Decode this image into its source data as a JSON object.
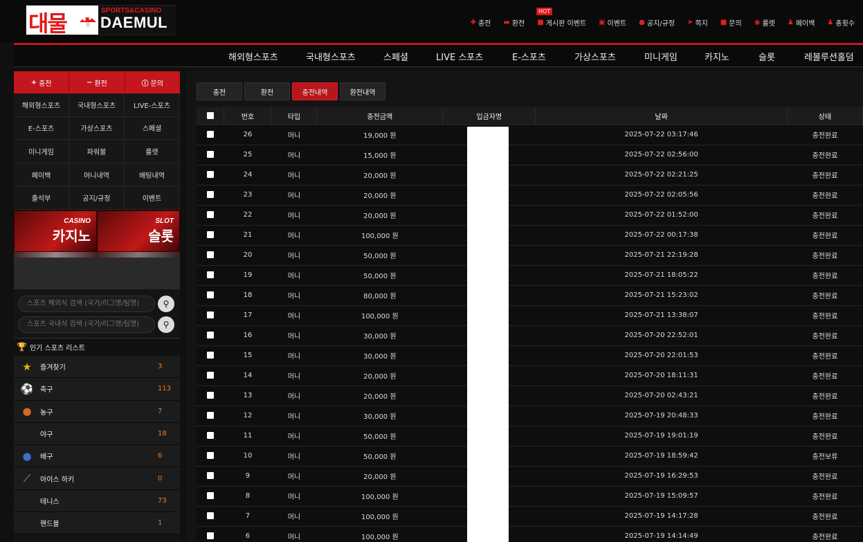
{
  "brand": {
    "logo_kr": "대물",
    "logo_sub": "SPORTS&CASINO",
    "logo_en": "DAEMUL"
  },
  "util_nav": [
    {
      "icon": "plus-icon",
      "label": "충전"
    },
    {
      "icon": "minus-icon",
      "label": "환전"
    },
    {
      "icon": "board-icon",
      "label": "게시판 이벤트"
    },
    {
      "icon": "calendar-icon",
      "label": "이벤트"
    },
    {
      "icon": "notice-icon",
      "label": "공지/규정"
    },
    {
      "icon": "message-icon",
      "label": "쪽지"
    },
    {
      "icon": "inquiry-icon",
      "label": "문의"
    },
    {
      "icon": "roulette-icon",
      "label": "룰렛"
    },
    {
      "icon": "payback-icon",
      "label": "페이백"
    },
    {
      "icon": "attendance-icon",
      "label": "총횟수"
    }
  ],
  "hot_badge": "HOT",
  "main_nav": [
    "해외형스포츠",
    "국내형스포츠",
    "스페셜",
    "LIVE 스포츠",
    "E-스포츠",
    "가상스포츠",
    "미니게임",
    "카지노",
    "슬롯",
    "레볼루션홀덤"
  ],
  "sidebar": {
    "actions": [
      {
        "icon": "plus-icon",
        "glyph": "+",
        "label": "충전"
      },
      {
        "icon": "minus-icon",
        "glyph": "−",
        "label": "환전"
      },
      {
        "icon": "info-icon",
        "glyph": "ⓘ",
        "label": "문의"
      }
    ],
    "grid": [
      "해외형스포츠",
      "국내형스포츠",
      "LIVE-스포츠",
      "E-스포츠",
      "가상스포츠",
      "스페셜",
      "미니게임",
      "파워볼",
      "룰렛",
      "페이백",
      "머니내역",
      "배팅내역",
      "출석부",
      "공지/규정",
      "이벤트"
    ],
    "banners": [
      {
        "title": "CASINO",
        "label": "카지노"
      },
      {
        "title": "SLOT",
        "label": "슬롯"
      }
    ],
    "search": [
      {
        "placeholder": "스포츠 해외식 검색 (국가/리그명/팀명)"
      },
      {
        "placeholder": "스포츠 국내식 검색 (국가/리그명/팀명)"
      }
    ],
    "popular_title": "인기 스포츠 리스트",
    "sports": [
      {
        "icon": "star-icon",
        "glyph": "★",
        "color": "#f2b400",
        "name": "즐겨찾기",
        "count": "3"
      },
      {
        "icon": "soccer-icon",
        "glyph": "⚽",
        "color": "#ffffff",
        "name": "축구",
        "count": "113"
      },
      {
        "icon": "basketball-icon",
        "glyph": "●",
        "color": "#d2691e",
        "name": "농구",
        "count": "7"
      },
      {
        "icon": "",
        "glyph": "",
        "color": "#ffffff",
        "name": "야구",
        "count": "18"
      },
      {
        "icon": "volleyball-icon",
        "glyph": "●",
        "color": "#3b6fd1",
        "name": "배구",
        "count": "6"
      },
      {
        "icon": "hockey-icon",
        "glyph": "⟋",
        "color": "#c8a060",
        "name": "아이스 하키",
        "count": "0"
      },
      {
        "icon": "",
        "glyph": "",
        "color": "#ffffff",
        "name": "테니스",
        "count": "73"
      },
      {
        "icon": "",
        "glyph": "",
        "color": "#ffffff",
        "name": "핸드볼",
        "count": "1"
      }
    ]
  },
  "tabs": [
    {
      "label": "충전",
      "active": false
    },
    {
      "label": "환전",
      "active": false
    },
    {
      "label": "충전내역",
      "active": true
    },
    {
      "label": "환전내역",
      "active": false
    }
  ],
  "table": {
    "headers": [
      "번호",
      "타입",
      "충전금액",
      "입금자명",
      "날짜",
      "상태"
    ],
    "rows": [
      {
        "no": "26",
        "type": "머니",
        "amount": "19,000 원",
        "name": "",
        "date": "2025-07-22 03:17:46",
        "status": "충전완료"
      },
      {
        "no": "25",
        "type": "머니",
        "amount": "15,000 원",
        "name": "",
        "date": "2025-07-22 02:56:00",
        "status": "충전완료"
      },
      {
        "no": "24",
        "type": "머니",
        "amount": "20,000 원",
        "name": "",
        "date": "2025-07-22 02:21:25",
        "status": "충전완료"
      },
      {
        "no": "23",
        "type": "머니",
        "amount": "20,000 원",
        "name": "",
        "date": "2025-07-22 02:05:56",
        "status": "충전완료"
      },
      {
        "no": "22",
        "type": "머니",
        "amount": "20,000 원",
        "name": "",
        "date": "2025-07-22 01:52:00",
        "status": "충전완료"
      },
      {
        "no": "21",
        "type": "머니",
        "amount": "100,000 원",
        "name": "",
        "date": "2025-07-22 00:17:38",
        "status": "충전완료"
      },
      {
        "no": "20",
        "type": "머니",
        "amount": "50,000 원",
        "name": "",
        "date": "2025-07-21 22:19:28",
        "status": "충전완료"
      },
      {
        "no": "19",
        "type": "머니",
        "amount": "50,000 원",
        "name": "",
        "date": "2025-07-21 18:05:22",
        "status": "충전완료"
      },
      {
        "no": "18",
        "type": "머니",
        "amount": "80,000 원",
        "name": "",
        "date": "2025-07-21 15:23:02",
        "status": "충전완료"
      },
      {
        "no": "17",
        "type": "머니",
        "amount": "100,000 원",
        "name": "",
        "date": "2025-07-21 13:38:07",
        "status": "충전완료"
      },
      {
        "no": "16",
        "type": "머니",
        "amount": "30,000 원",
        "name": "",
        "date": "2025-07-20 22:52:01",
        "status": "충전완료"
      },
      {
        "no": "15",
        "type": "머니",
        "amount": "30,000 원",
        "name": "",
        "date": "2025-07-20 22:01:53",
        "status": "충전완료"
      },
      {
        "no": "14",
        "type": "머니",
        "amount": "20,000 원",
        "name": "",
        "date": "2025-07-20 18:11:31",
        "status": "충전완료"
      },
      {
        "no": "13",
        "type": "머니",
        "amount": "20,000 원",
        "name": "",
        "date": "2025-07-20 02:43:21",
        "status": "충전완료"
      },
      {
        "no": "12",
        "type": "머니",
        "amount": "30,000 원",
        "name": "",
        "date": "2025-07-19 20:48:33",
        "status": "충전완료"
      },
      {
        "no": "11",
        "type": "머니",
        "amount": "50,000 원",
        "name": "",
        "date": "2025-07-19 19:01:19",
        "status": "충전완료"
      },
      {
        "no": "10",
        "type": "머니",
        "amount": "50,000 원",
        "name": "",
        "date": "2025-07-19 18:59:42",
        "status": "충전보류"
      },
      {
        "no": "9",
        "type": "머니",
        "amount": "20,000 원",
        "name": "",
        "date": "2025-07-19 16:29:53",
        "status": "충전완료"
      },
      {
        "no": "8",
        "type": "머니",
        "amount": "100,000 원",
        "name": "",
        "date": "2025-07-19 15:09:57",
        "status": "충전완료"
      },
      {
        "no": "7",
        "type": "머니",
        "amount": "100,000 원",
        "name": "",
        "date": "2025-07-19 14:17:28",
        "status": "충전완료"
      },
      {
        "no": "6",
        "type": "머니",
        "amount": "100,000 원",
        "name": "",
        "date": "2025-07-19 14:14:49",
        "status": "충전완료"
      }
    ]
  },
  "colors": {
    "accent": "#c4161c",
    "count": "#f07a1a"
  }
}
